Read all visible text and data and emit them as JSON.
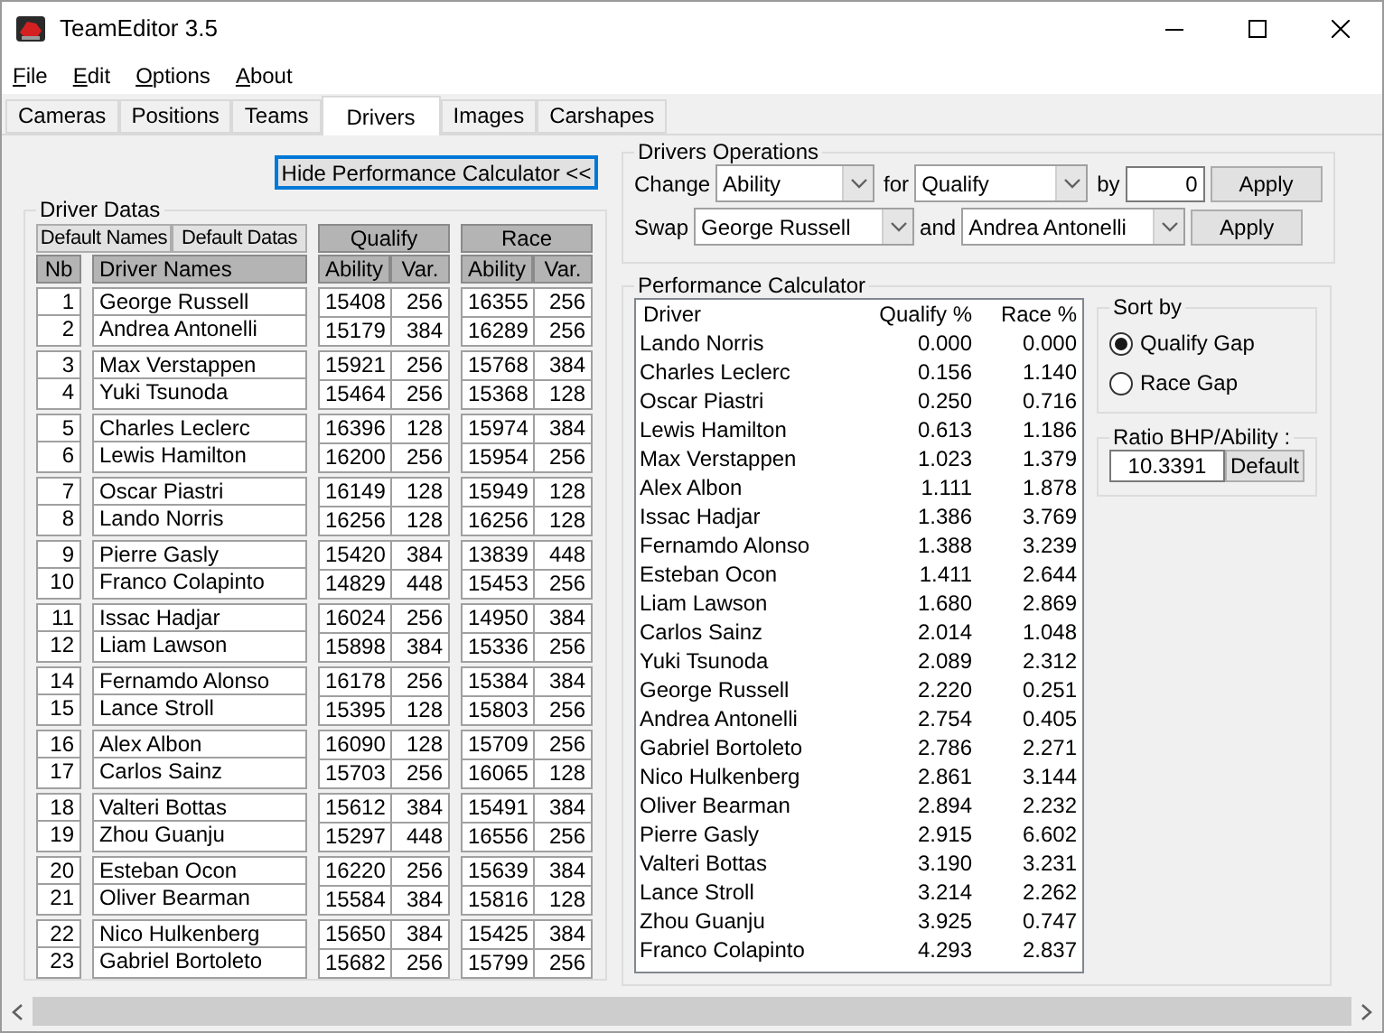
{
  "window": {
    "title": "TeamEditor 3.5"
  },
  "menu": [
    "File",
    "Edit",
    "Options",
    "About"
  ],
  "tabs": [
    {
      "label": "Cameras",
      "selected": false
    },
    {
      "label": "Positions",
      "selected": false
    },
    {
      "label": "Teams",
      "selected": false
    },
    {
      "label": "Drivers",
      "selected": true
    },
    {
      "label": "Images",
      "selected": false
    },
    {
      "label": "Carshapes",
      "selected": false
    }
  ],
  "toggle_button": "Hide Performance Calculator <<",
  "driver_datas": {
    "title": "Driver Datas",
    "buttons": [
      "Default Names",
      "Default Datas"
    ],
    "groups": [
      "Qualify",
      "Race"
    ],
    "columns": [
      "Nb",
      "Driver Names",
      "Ability",
      "Var.",
      "Ability",
      "Var."
    ],
    "teams": [
      {
        "drivers": [
          {
            "nb": "1",
            "name": "George Russell",
            "q_ability": "15408",
            "q_var": "256",
            "r_ability": "16355",
            "r_var": "256"
          },
          {
            "nb": "2",
            "name": "Andrea Antonelli",
            "q_ability": "15179",
            "q_var": "384",
            "r_ability": "16289",
            "r_var": "256"
          }
        ]
      },
      {
        "drivers": [
          {
            "nb": "3",
            "name": "Max Verstappen",
            "q_ability": "15921",
            "q_var": "256",
            "r_ability": "15768",
            "r_var": "384"
          },
          {
            "nb": "4",
            "name": "Yuki Tsunoda",
            "q_ability": "15464",
            "q_var": "256",
            "r_ability": "15368",
            "r_var": "128"
          }
        ]
      },
      {
        "drivers": [
          {
            "nb": "5",
            "name": "Charles Leclerc",
            "q_ability": "16396",
            "q_var": "128",
            "r_ability": "15974",
            "r_var": "384"
          },
          {
            "nb": "6",
            "name": "Lewis Hamilton",
            "q_ability": "16200",
            "q_var": "256",
            "r_ability": "15954",
            "r_var": "256"
          }
        ]
      },
      {
        "drivers": [
          {
            "nb": "7",
            "name": "Oscar Piastri",
            "q_ability": "16149",
            "q_var": "128",
            "r_ability": "15949",
            "r_var": "128"
          },
          {
            "nb": "8",
            "name": "Lando Norris",
            "q_ability": "16256",
            "q_var": "128",
            "r_ability": "16256",
            "r_var": "128"
          }
        ]
      },
      {
        "drivers": [
          {
            "nb": "9",
            "name": "Pierre Gasly",
            "q_ability": "15420",
            "q_var": "384",
            "r_ability": "13839",
            "r_var": "448"
          },
          {
            "nb": "10",
            "name": "Franco Colapinto",
            "q_ability": "14829",
            "q_var": "448",
            "r_ability": "15453",
            "r_var": "256"
          }
        ]
      },
      {
        "drivers": [
          {
            "nb": "11",
            "name": "Issac Hadjar",
            "q_ability": "16024",
            "q_var": "256",
            "r_ability": "14950",
            "r_var": "384"
          },
          {
            "nb": "12",
            "name": "Liam Lawson",
            "q_ability": "15898",
            "q_var": "384",
            "r_ability": "15336",
            "r_var": "256"
          }
        ]
      },
      {
        "drivers": [
          {
            "nb": "14",
            "name": "Fernamdo Alonso",
            "q_ability": "16178",
            "q_var": "256",
            "r_ability": "15384",
            "r_var": "384"
          },
          {
            "nb": "15",
            "name": "Lance Stroll",
            "q_ability": "15395",
            "q_var": "128",
            "r_ability": "15803",
            "r_var": "256"
          }
        ]
      },
      {
        "drivers": [
          {
            "nb": "16",
            "name": "Alex Albon",
            "q_ability": "16090",
            "q_var": "128",
            "r_ability": "15709",
            "r_var": "256"
          },
          {
            "nb": "17",
            "name": "Carlos Sainz",
            "q_ability": "15703",
            "q_var": "256",
            "r_ability": "16065",
            "r_var": "128"
          }
        ]
      },
      {
        "drivers": [
          {
            "nb": "18",
            "name": "Valteri Bottas",
            "q_ability": "15612",
            "q_var": "384",
            "r_ability": "15491",
            "r_var": "384"
          },
          {
            "nb": "19",
            "name": "Zhou Guanju",
            "q_ability": "15297",
            "q_var": "448",
            "r_ability": "16556",
            "r_var": "256"
          }
        ]
      },
      {
        "drivers": [
          {
            "nb": "20",
            "name": "Esteban Ocon",
            "q_ability": "16220",
            "q_var": "256",
            "r_ability": "15639",
            "r_var": "384"
          },
          {
            "nb": "21",
            "name": "Oliver Bearman",
            "q_ability": "15584",
            "q_var": "384",
            "r_ability": "15816",
            "r_var": "128"
          }
        ]
      },
      {
        "drivers": [
          {
            "nb": "22",
            "name": "Nico Hulkenberg",
            "q_ability": "15650",
            "q_var": "384",
            "r_ability": "15425",
            "r_var": "384"
          },
          {
            "nb": "23",
            "name": "Gabriel Bortoleto",
            "q_ability": "15682",
            "q_var": "256",
            "r_ability": "15799",
            "r_var": "256"
          }
        ]
      }
    ]
  },
  "drivers_operations": {
    "title": "Drivers Operations",
    "change": {
      "label": "Change",
      "field": "Ability",
      "for_label": "for",
      "for_field": "Qualify",
      "by_label": "by",
      "by_value": "0",
      "button": "Apply"
    },
    "swap": {
      "label": "Swap",
      "first": "George Russell",
      "and_label": "and",
      "second": "Andrea Antonelli",
      "button": "Apply"
    }
  },
  "performance_calculator": {
    "title": "Performance Calculator",
    "columns": [
      "Driver",
      "Qualify %",
      "Race %"
    ],
    "rows": [
      {
        "driver": "Lando Norris",
        "qualify": "0.000",
        "race": "0.000"
      },
      {
        "driver": "Charles Leclerc",
        "qualify": "0.156",
        "race": "1.140"
      },
      {
        "driver": "Oscar Piastri",
        "qualify": "0.250",
        "race": "0.716"
      },
      {
        "driver": "Lewis Hamilton",
        "qualify": "0.613",
        "race": "1.186"
      },
      {
        "driver": "Max Verstappen",
        "qualify": "1.023",
        "race": "1.379"
      },
      {
        "driver": "Alex Albon",
        "qualify": "1.111",
        "race": "1.878"
      },
      {
        "driver": "Issac Hadjar",
        "qualify": "1.386",
        "race": "3.769"
      },
      {
        "driver": "Fernamdo Alonso",
        "qualify": "1.388",
        "race": "3.239"
      },
      {
        "driver": "Esteban Ocon",
        "qualify": "1.411",
        "race": "2.644"
      },
      {
        "driver": "Liam Lawson",
        "qualify": "1.680",
        "race": "2.869"
      },
      {
        "driver": "Carlos Sainz",
        "qualify": "2.014",
        "race": "1.048"
      },
      {
        "driver": "Yuki Tsunoda",
        "qualify": "2.089",
        "race": "2.312"
      },
      {
        "driver": "George Russell",
        "qualify": "2.220",
        "race": "0.251"
      },
      {
        "driver": "Andrea Antonelli",
        "qualify": "2.754",
        "race": "0.405"
      },
      {
        "driver": "Gabriel Bortoleto",
        "qualify": "2.786",
        "race": "2.271"
      },
      {
        "driver": "Nico Hulkenberg",
        "qualify": "2.861",
        "race": "3.144"
      },
      {
        "driver": "Oliver Bearman",
        "qualify": "2.894",
        "race": "2.232"
      },
      {
        "driver": "Pierre Gasly",
        "qualify": "2.915",
        "race": "6.602"
      },
      {
        "driver": "Valteri Bottas",
        "qualify": "3.190",
        "race": "3.231"
      },
      {
        "driver": "Lance Stroll",
        "qualify": "3.214",
        "race": "2.262"
      },
      {
        "driver": "Zhou Guanju",
        "qualify": "3.925",
        "race": "0.747"
      },
      {
        "driver": "Franco Colapinto",
        "qualify": "4.293",
        "race": "2.837"
      }
    ],
    "sort_by": {
      "title": "Sort by",
      "options": [
        {
          "label": "Qualify Gap",
          "selected": true
        },
        {
          "label": "Race Gap",
          "selected": false
        }
      ]
    },
    "ratio": {
      "title": "Ratio BHP/Ability :",
      "value": "10.3391",
      "button": "Default"
    }
  }
}
